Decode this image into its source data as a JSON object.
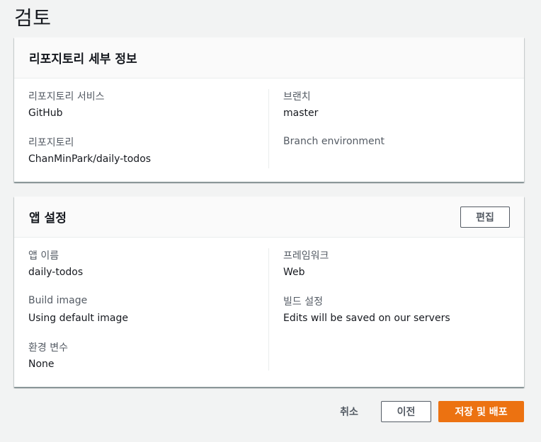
{
  "page": {
    "title": "검토"
  },
  "repo_panel": {
    "title": "리포지토리 세부 정보",
    "fields": [
      {
        "label": "리포지토리 서비스",
        "value": "GitHub"
      },
      {
        "label": "리포지토리",
        "value": "ChanMinPark/daily-todos"
      },
      {
        "label": "브랜치",
        "value": "master"
      },
      {
        "label": "Branch environment",
        "value": ""
      }
    ]
  },
  "app_panel": {
    "title": "앱 설정",
    "edit_label": "편집",
    "fields": [
      {
        "label": "앱 이름",
        "value": "daily-todos"
      },
      {
        "label": "Build image",
        "value": "Using default image"
      },
      {
        "label": "환경 변수",
        "value": "None"
      },
      {
        "label": "프레임워크",
        "value": "Web"
      },
      {
        "label": "빌드 설정",
        "value": "Edits will be saved on our servers"
      }
    ]
  },
  "footer": {
    "cancel_label": "취소",
    "previous_label": "이전",
    "save_deploy_label": "저장 및 배포"
  },
  "colors": {
    "primary": "#ec7211",
    "background": "#f2f3f3",
    "text": "#16191f",
    "label": "#545b64"
  }
}
